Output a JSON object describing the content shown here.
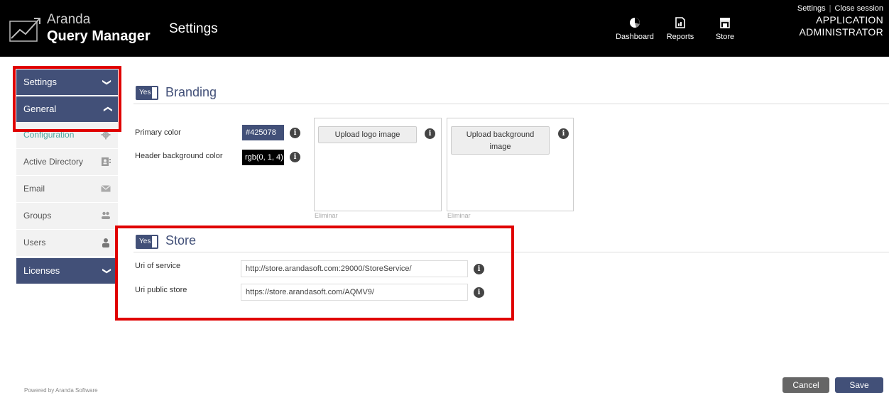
{
  "header": {
    "brand": "Aranda",
    "product": "Query Manager",
    "title": "Settings",
    "nav": [
      {
        "label": "Dashboard",
        "icon": "dashboard-icon"
      },
      {
        "label": "Reports",
        "icon": "reports-icon"
      },
      {
        "label": "Store",
        "icon": "store-icon"
      }
    ],
    "links": {
      "settings": "Settings",
      "close_session": "Close session"
    },
    "user": {
      "line1": "APPLICATION",
      "line2": "ADMINISTRATOR"
    }
  },
  "sidebar": {
    "settings_label": "Settings",
    "general_label": "General",
    "items": [
      {
        "label": "Configuration",
        "icon": "gear-icon"
      },
      {
        "label": "Active Directory",
        "icon": "address-book-icon"
      },
      {
        "label": "Email",
        "icon": "envelope-icon"
      },
      {
        "label": "Groups",
        "icon": "group-icon"
      },
      {
        "label": "Users",
        "icon": "user-icon"
      }
    ],
    "licenses_label": "Licenses"
  },
  "branding": {
    "toggle": "Yes",
    "title": "Branding",
    "primary_color_label": "Primary color",
    "primary_color_value": "#425078",
    "header_bg_label": "Header background color",
    "header_bg_value": "rgb(0, 1, 4)",
    "upload_logo": "Upload logo image",
    "upload_background": "Upload background image",
    "eliminar": "Eliminar"
  },
  "store": {
    "toggle": "Yes",
    "title": "Store",
    "uri_service_label": "Uri of service",
    "uri_service_value": "http://store.arandasoft.com:29000/StoreService/",
    "uri_public_label": "Uri public store",
    "uri_public_value": "https://store.arandasoft.com/AQMV9/"
  },
  "footer": {
    "powered": "Powered by Aranda Software",
    "cancel": "Cancel",
    "save": "Save"
  },
  "colors": {
    "accent": "#425078",
    "highlight": "#e00000",
    "active_item": "#4ea39e"
  }
}
